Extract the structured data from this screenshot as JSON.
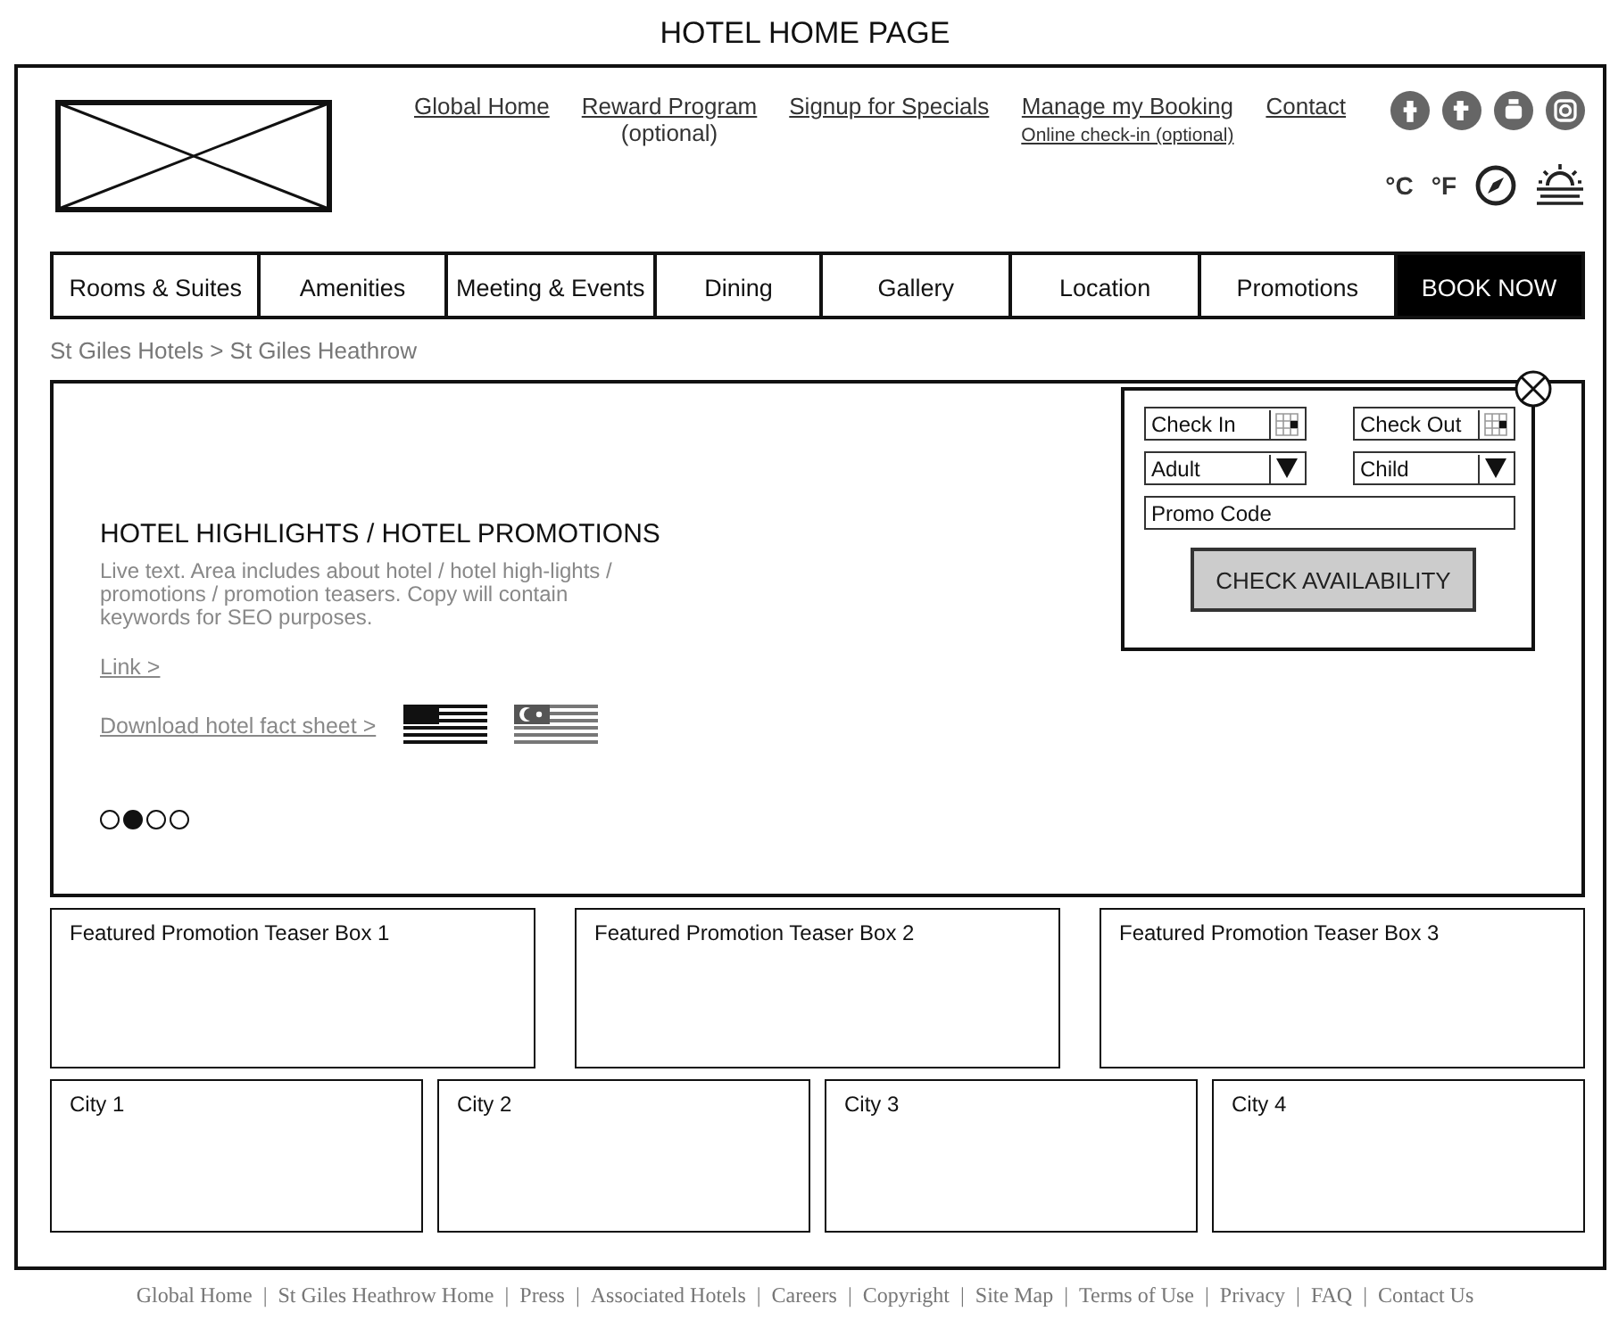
{
  "page_title": "HOTEL HOME PAGE",
  "header": {
    "top_links": [
      {
        "label": "Global Home"
      },
      {
        "label": "Reward Program",
        "note": "(optional)",
        "note_underlined": false
      },
      {
        "label": "Signup for Specials"
      },
      {
        "label": "Manage my Booking",
        "note": "Online check-in (optional)",
        "note_underlined": true
      },
      {
        "label": "Contact"
      }
    ],
    "units": [
      "°C",
      "°F"
    ]
  },
  "nav": [
    {
      "label": "Rooms & Suites",
      "kind": "tab"
    },
    {
      "label": "Amenities",
      "kind": "tab"
    },
    {
      "label": "Meeting & Events",
      "kind": "tab"
    },
    {
      "label": "Dining",
      "kind": "tab"
    },
    {
      "label": "Gallery",
      "kind": "tab"
    },
    {
      "label": "Location",
      "kind": "tab"
    },
    {
      "label": "Promotions",
      "kind": "tab"
    },
    {
      "label": "BOOK NOW",
      "kind": "cta"
    }
  ],
  "breadcrumb": "St Giles Hotels > St Giles Heathrow",
  "hero": {
    "heading": "HOTEL HIGHLIGHTS / HOTEL PROMOTIONS",
    "body": "Live text. Area includes about hotel / hotel high-lights / promotions / promotion teasers. Copy will contain keywords for SEO purposes.",
    "link": "Link >",
    "download": "Download hotel fact sheet >",
    "dots": [
      {
        "selected": false
      },
      {
        "selected": true
      },
      {
        "selected": false
      },
      {
        "selected": false
      }
    ]
  },
  "booking": {
    "fields": [
      {
        "kind": "date",
        "placeholder": "Check In"
      },
      {
        "kind": "date",
        "placeholder": "Check Out"
      },
      {
        "kind": "select",
        "value": "Adult"
      },
      {
        "kind": "select",
        "value": "Child"
      },
      {
        "kind": "text",
        "placeholder": "Promo Code"
      }
    ],
    "button": "CHECK AVAILABILITY"
  },
  "promos": [
    "Featured Promotion Teaser Box 1",
    "Featured Promotion Teaser Box 2",
    "Featured Promotion Teaser Box 3"
  ],
  "cities": [
    "City 1",
    "City 2",
    "City 3",
    "City 4"
  ],
  "footer_separator": "|",
  "footer_links": [
    "Global Home",
    "St Giles Heathrow Home",
    "Press",
    "Associated Hotels",
    "Careers",
    "Copyright",
    "Site Map",
    "Terms of Use",
    "Privacy",
    "FAQ",
    "Contact Us"
  ]
}
